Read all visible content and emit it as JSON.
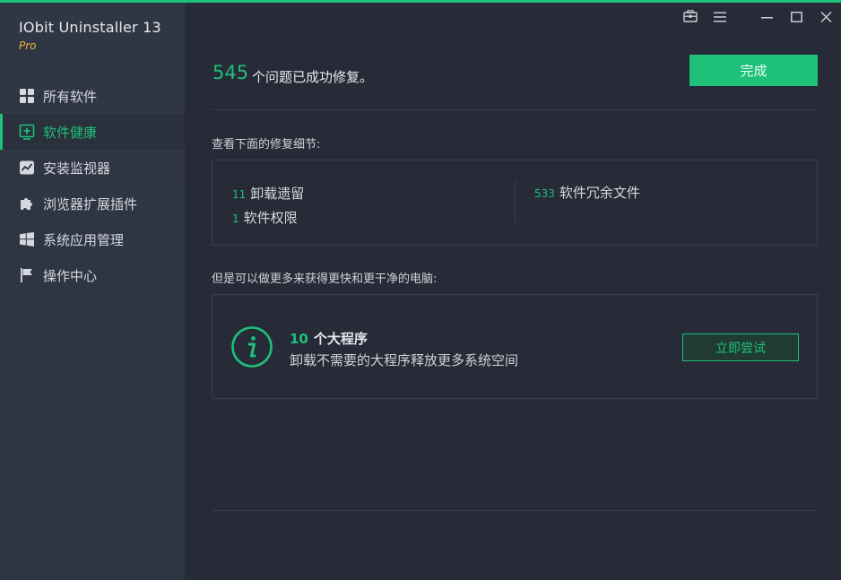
{
  "app": {
    "title": "IObit Uninstaller 13",
    "edition": "Pro",
    "accent_color": "#1ec07a"
  },
  "sidebar": {
    "items": [
      {
        "label": "所有软件",
        "icon": "grid-icon"
      },
      {
        "label": "软件健康",
        "icon": "health-plus-icon",
        "active": true
      },
      {
        "label": "安装监视器",
        "icon": "monitor-chart-icon"
      },
      {
        "label": "浏览器扩展插件",
        "icon": "puzzle-icon"
      },
      {
        "label": "系统应用管理",
        "icon": "windows-icon"
      },
      {
        "label": "操作中心",
        "icon": "flag-icon"
      }
    ]
  },
  "titlebar": {
    "icons": [
      "toolbox-icon",
      "menu-icon",
      "minimize-icon",
      "maximize-icon",
      "close-icon"
    ]
  },
  "result": {
    "count": "545",
    "text": "个问题已成功修复。",
    "done_label": "完成"
  },
  "details": {
    "heading": "查看下面的修复细节:",
    "items": [
      {
        "count": "11",
        "label": "卸载遗留"
      },
      {
        "count": "1",
        "label": "软件权限"
      },
      {
        "count": "533",
        "label": "软件冗余文件"
      }
    ]
  },
  "promo": {
    "heading": "但是可以做更多来获得更快和更干净的电脑:",
    "count": "10",
    "title": "个大程序",
    "description": "卸载不需要的大程序释放更多系统空间",
    "button_label": "立即尝试"
  }
}
